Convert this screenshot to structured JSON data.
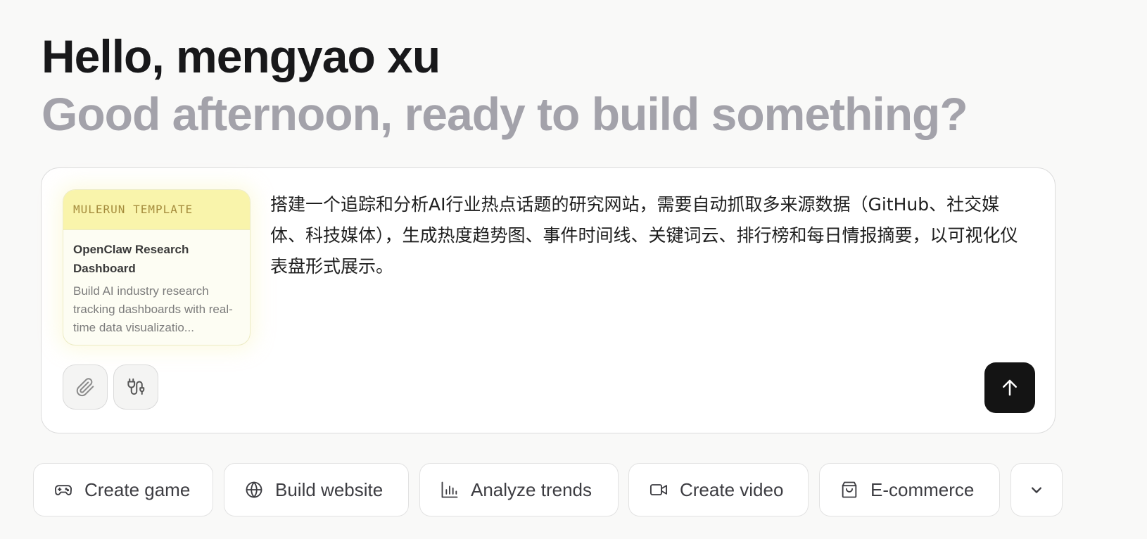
{
  "header": {
    "greeting": "Hello, mengyao xu",
    "subgreeting": "Good afternoon, ready to build something?"
  },
  "composer": {
    "template": {
      "tag": "MULERUN TEMPLATE",
      "title": "OpenClaw Research Dashboard",
      "description": "Build AI industry research tracking dashboards with real-time data visualizatio..."
    },
    "prompt_text": "搭建一个追踪和分析AI行业热点话题的研究网站，需要自动抓取多来源数据（GitHub、社交媒体、科技媒体），生成热度趋势图、事件时间线、关键词云、排行榜和每日情报摘要，以可视化仪表盘形式展示。",
    "tools": [
      {
        "icon": "paperclip-icon",
        "label": "attach"
      },
      {
        "icon": "plug-icon",
        "label": "plugins"
      }
    ],
    "send_icon": "arrow-up-icon"
  },
  "quick_actions": [
    {
      "icon": "gamepad-icon",
      "label": "Create game"
    },
    {
      "icon": "globe-icon",
      "label": "Build website"
    },
    {
      "icon": "bar-chart-icon",
      "label": "Analyze trends"
    },
    {
      "icon": "video-camera-icon",
      "label": "Create video"
    },
    {
      "icon": "shopping-bag-icon",
      "label": "E-commerce"
    }
  ],
  "more_icon": "chevron-down-icon",
  "colors": {
    "background": "#f9f9f8",
    "greeting": "#18181a",
    "subgreeting": "#a3a2aa",
    "template_header": "#f9f4ab",
    "template_tag": "#a58c3d",
    "send_button": "#141414"
  }
}
